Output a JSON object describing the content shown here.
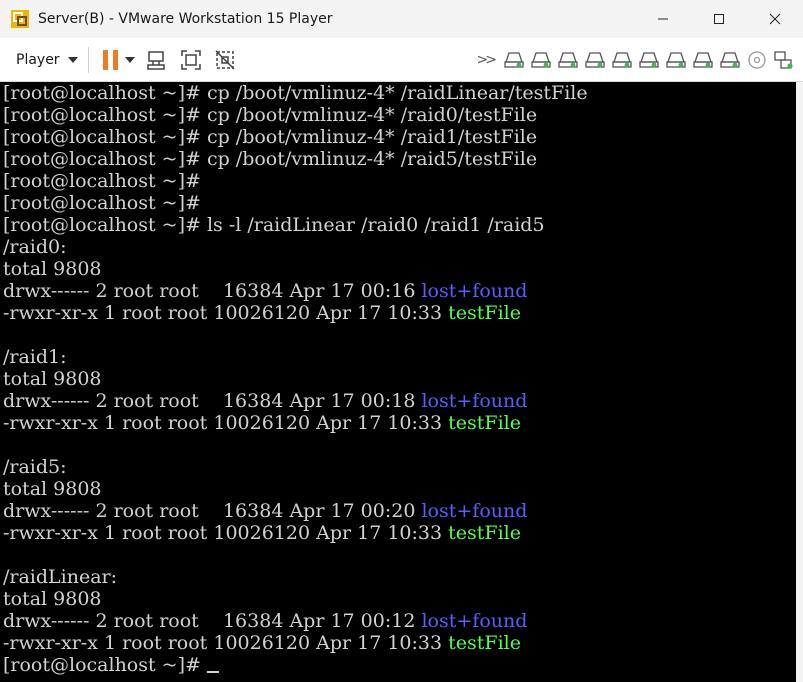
{
  "window": {
    "title": "Server(B) - VMware Workstation 15 Player"
  },
  "toolbar": {
    "player_label": "Player"
  },
  "terminal": {
    "lines": [
      {
        "text": "[root@localhost ~]# cp /boot/vmlinuz-4* /raidLinear/testFile"
      },
      {
        "text": "[root@localhost ~]# cp /boot/vmlinuz-4* /raid0/testFile"
      },
      {
        "text": "[root@localhost ~]# cp /boot/vmlinuz-4* /raid1/testFile"
      },
      {
        "text": "[root@localhost ~]# cp /boot/vmlinuz-4* /raid5/testFile"
      },
      {
        "text": "[root@localhost ~]#"
      },
      {
        "text": "[root@localhost ~]#"
      },
      {
        "text": "[root@localhost ~]# ls -l /raidLinear /raid0 /raid1 /raid5"
      },
      {
        "text": "/raid0:"
      },
      {
        "text": "total 9808"
      },
      {
        "text": "drwx------ 2 root root    16384 Apr 17 00:16 ",
        "name": "lost+found",
        "color": "blue"
      },
      {
        "text": "-rwxr-xr-x 1 root root 10026120 Apr 17 10:33 ",
        "name": "testFile",
        "color": "green"
      },
      {
        "text": ""
      },
      {
        "text": "/raid1:"
      },
      {
        "text": "total 9808"
      },
      {
        "text": "drwx------ 2 root root    16384 Apr 17 00:18 ",
        "name": "lost+found",
        "color": "blue"
      },
      {
        "text": "-rwxr-xr-x 1 root root 10026120 Apr 17 10:33 ",
        "name": "testFile",
        "color": "green"
      },
      {
        "text": ""
      },
      {
        "text": "/raid5:"
      },
      {
        "text": "total 9808"
      },
      {
        "text": "drwx------ 2 root root    16384 Apr 17 00:20 ",
        "name": "lost+found",
        "color": "blue"
      },
      {
        "text": "-rwxr-xr-x 1 root root 10026120 Apr 17 10:33 ",
        "name": "testFile",
        "color": "green"
      },
      {
        "text": ""
      },
      {
        "text": "/raidLinear:"
      },
      {
        "text": "total 9808"
      },
      {
        "text": "drwx------ 2 root root    16384 Apr 17 00:12 ",
        "name": "lost+found",
        "color": "blue"
      },
      {
        "text": "-rwxr-xr-x 1 root root 10026120 Apr 17 10:33 ",
        "name": "testFile",
        "color": "green"
      },
      {
        "text": "[root@localhost ~]# ",
        "cursor": true
      }
    ]
  },
  "colors": {
    "terminal_bg": "#000000",
    "terminal_fg": "#d2d2d2",
    "dir_color": "#5c5cff",
    "exec_color": "#54ff54",
    "pause_color": "#f07b22",
    "device_green": "#4caf50"
  },
  "icons": {
    "app": "vmware-icon",
    "pause": "pause-icon",
    "send_ctrl_alt_del": "send-keys-icon",
    "fit_guest": "fit-window-icon",
    "unity": "unity-icon",
    "more": "chevron-double-right-icon",
    "device": "hard-disk-icon",
    "cd": "cd-icon",
    "network": "network-icon"
  }
}
